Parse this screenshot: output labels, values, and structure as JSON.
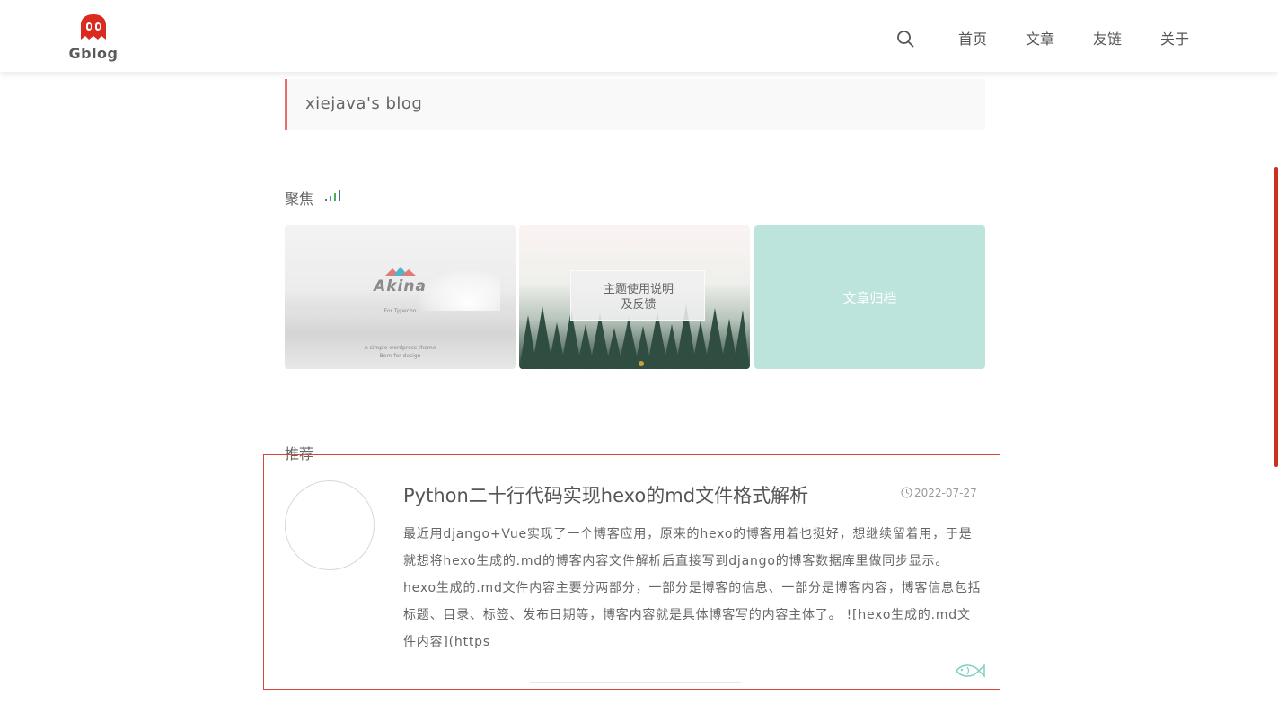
{
  "header": {
    "logo_text": "Gblog",
    "nav": [
      {
        "label": "首页"
      },
      {
        "label": "文章"
      },
      {
        "label": "友链"
      },
      {
        "label": "关于"
      }
    ]
  },
  "site": {
    "description": "xiejava's blog"
  },
  "focus": {
    "title": "聚焦",
    "cards": [
      {
        "name": "akina-card",
        "title": "Akina",
        "subtitle": "For Typecho",
        "footer_line1": "A simple wordpress theme",
        "footer_line2": "Born for design"
      },
      {
        "name": "theme-guide-card",
        "label_line1": "主题使用说明",
        "label_line2": "及反馈"
      },
      {
        "name": "archive-card",
        "label": "文章归档"
      }
    ]
  },
  "recommend": {
    "title": "推荐",
    "posts": [
      {
        "title": "Python二十行代码实现hexo的md文件格式解析",
        "date": "2022-07-27",
        "excerpt": "最近用django+Vue实现了一个博客应用，原来的hexo的博客用着也挺好，想继续留着用，于是就想将hexo生成的.md的博客内容文件解析后直接写到django的博客数据库里做同步显示。 hexo生成的.md文件内容主要分两部分，一部分是博客的信息、一部分是博客内容，博客信息包括标题、目录、标签、发布日期等，博客内容就是具体博客写的内容主体了。 ![hexo生成的.md文件内容](https"
      }
    ]
  },
  "colors": {
    "accent_red": "#d9453a",
    "title_bar_border": "#e96b6b",
    "archive_card_bg": "#bde4dc",
    "scrollbar": "#c9321f"
  }
}
